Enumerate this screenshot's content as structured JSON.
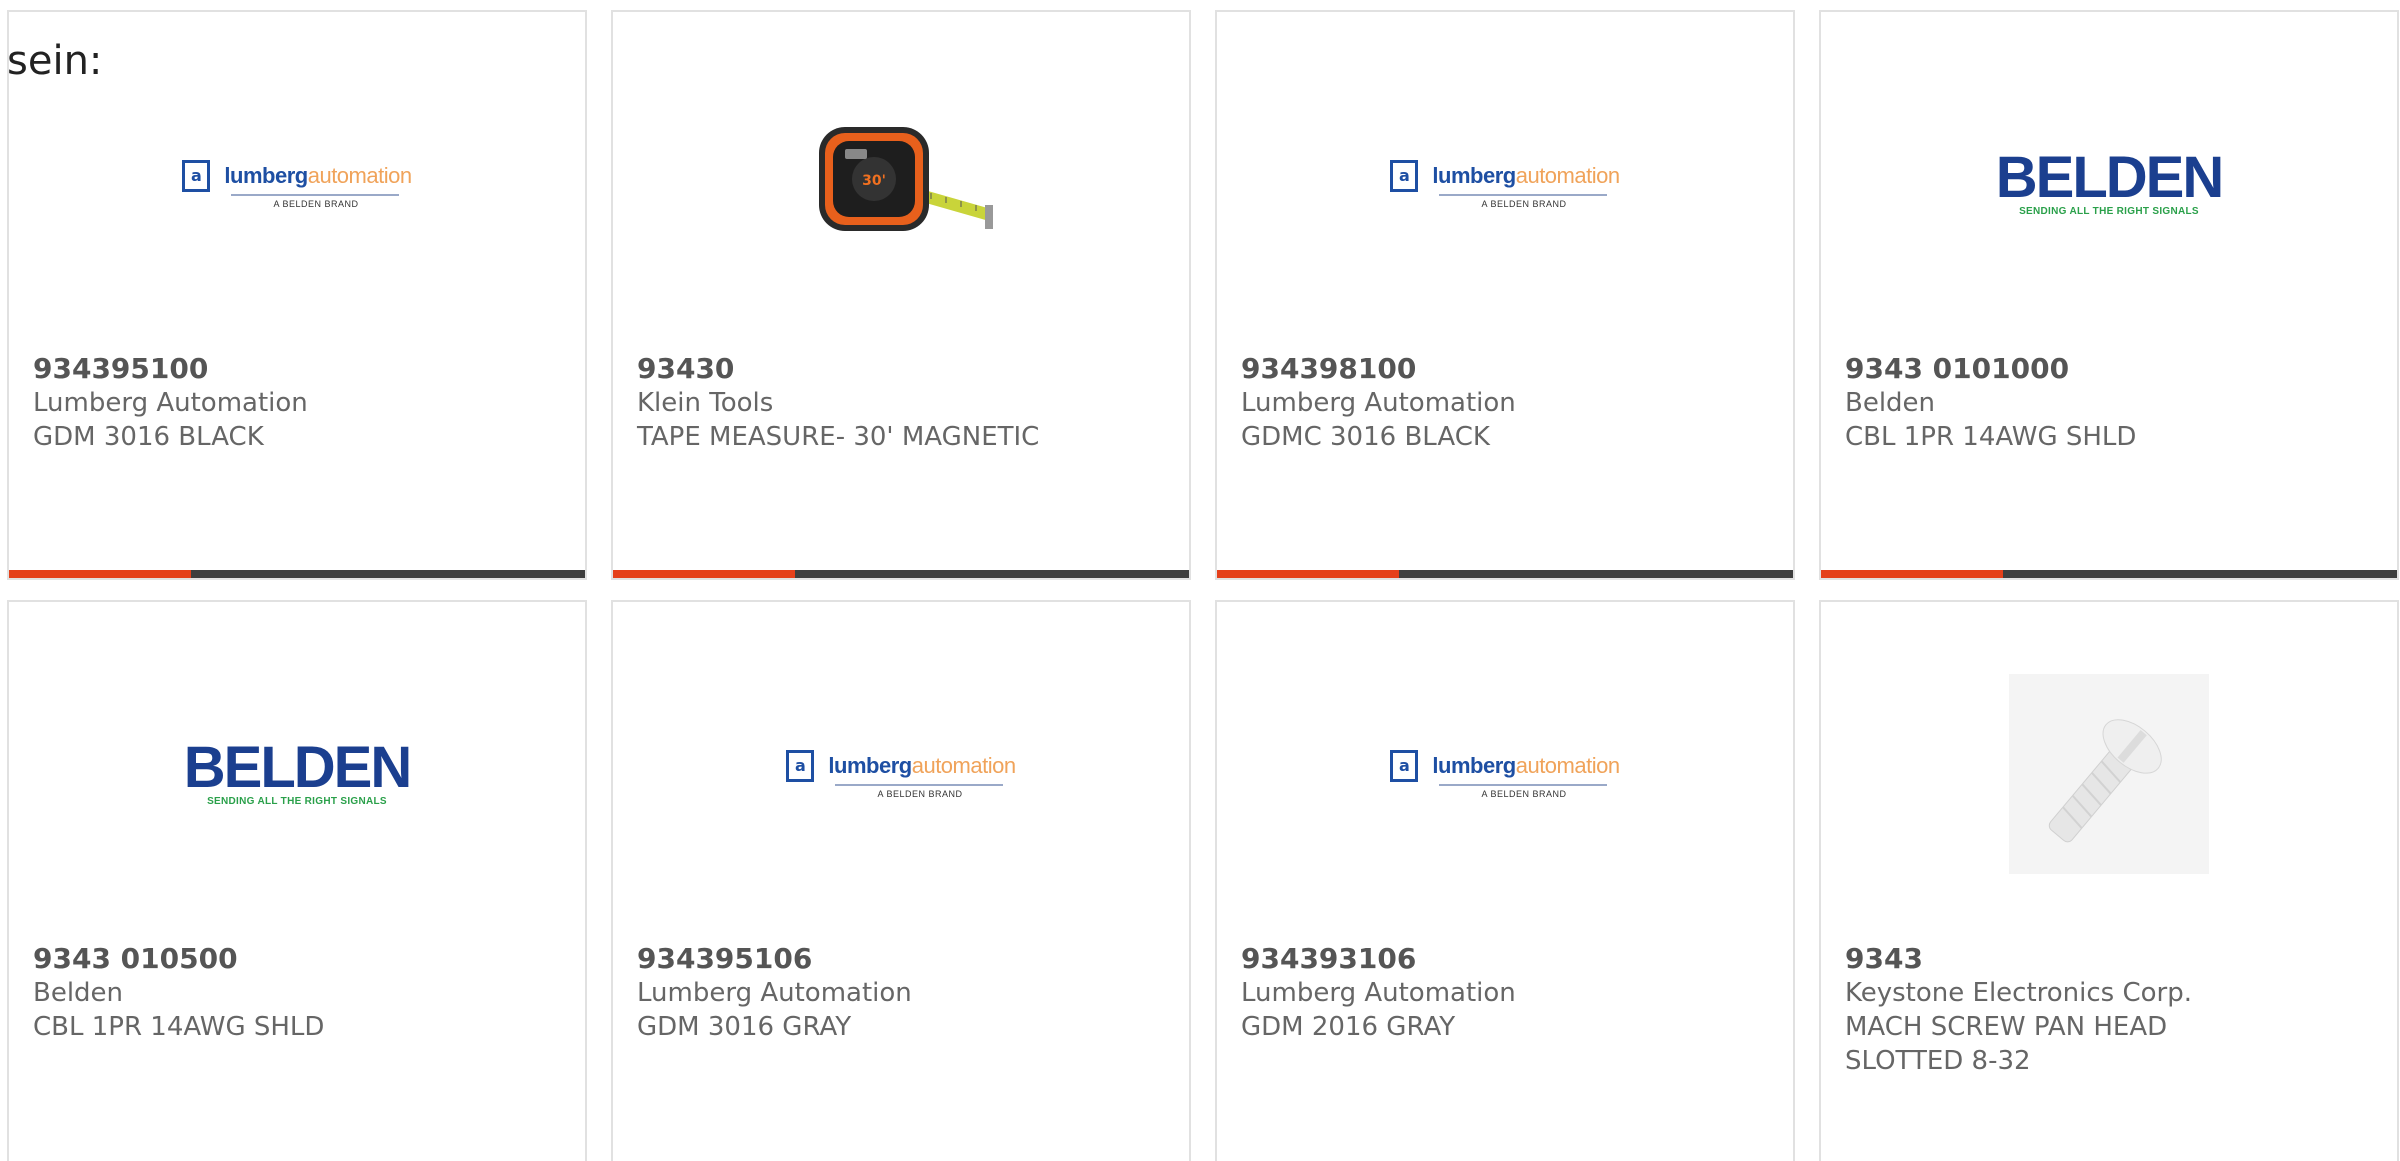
{
  "heading": "sein:",
  "products": [
    {
      "part_number": "934395100",
      "manufacturer": "Lumberg Automation",
      "description": [
        "GDM 3016 BLACK"
      ],
      "image": "lumberg-logo"
    },
    {
      "part_number": "93430",
      "manufacturer": "Klein Tools",
      "description": [
        "TAPE MEASURE- 30' MAGNETIC"
      ],
      "image": "tape-measure-photo"
    },
    {
      "part_number": "934398100",
      "manufacturer": "Lumberg Automation",
      "description": [
        "GDMC 3016 BLACK"
      ],
      "image": "lumberg-logo"
    },
    {
      "part_number": "9343 0101000",
      "manufacturer": "Belden",
      "description": [
        "CBL 1PR 14AWG SHLD"
      ],
      "image": "belden-logo"
    },
    {
      "part_number": "9343 010500",
      "manufacturer": "Belden",
      "description": [
        "CBL 1PR 14AWG SHLD"
      ],
      "image": "belden-logo"
    },
    {
      "part_number": "934395106",
      "manufacturer": "Lumberg Automation",
      "description": [
        "GDM 3016 GRAY"
      ],
      "image": "lumberg-logo"
    },
    {
      "part_number": "934393106",
      "manufacturer": "Lumberg Automation",
      "description": [
        "GDM 2016 GRAY"
      ],
      "image": "lumberg-logo"
    },
    {
      "part_number": "9343",
      "manufacturer": "Keystone Electronics Corp.",
      "description": [
        "MACH SCREW PAN HEAD",
        "SLOTTED 8-32"
      ],
      "image": "screw-photo"
    }
  ],
  "logos": {
    "lumberg_icon": "a",
    "lumberg_word_a": "lumberg",
    "lumberg_word_b": "automation",
    "lumberg_sub": "A BELDEN BRAND",
    "belden_word": "BELDEN",
    "belden_tag": "SENDING ALL THE RIGHT SIGNALS",
    "tape_label": "30'"
  },
  "colors": {
    "accent_bar": "#e5401a",
    "bar": "#3e3e3e",
    "card_border": "#e1e1e1",
    "text": "#666666",
    "lumberg_blue": "#1e4fa3",
    "lumberg_orange": "#f0a35a",
    "belden_blue": "#1b3f8f",
    "belden_green": "#2aa04a"
  }
}
